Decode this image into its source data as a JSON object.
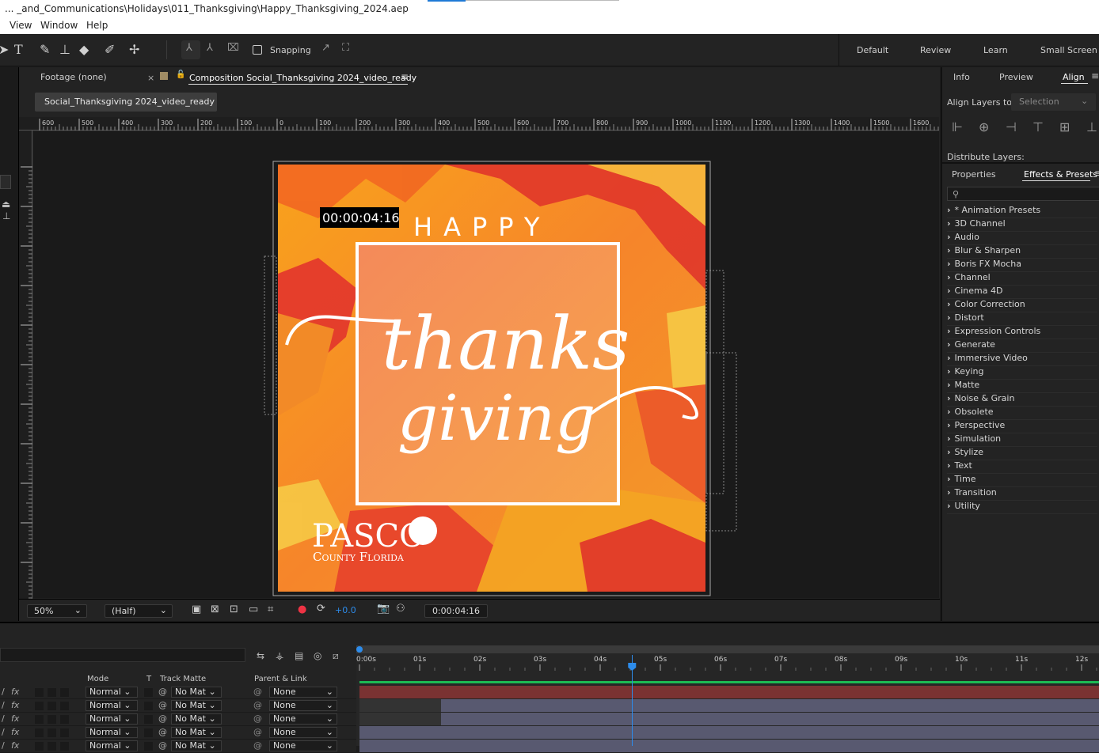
{
  "window": {
    "title": "... _and_Communications\\Holidays\\011_Thanksgiving\\Happy_Thanksgiving_2024.aep"
  },
  "menu": [
    "View",
    "Window",
    "Help"
  ],
  "toolbar": {
    "snapping_label": "Snapping",
    "workspaces": [
      "Default",
      "Review",
      "Learn",
      "Small Screen"
    ]
  },
  "comp_panel": {
    "footage_tab": "Footage (none)",
    "comp_tab": "Composition Social_Thanksgiving 2024_video_ready",
    "breadcrumb": "Social_Thanksgiving 2024_video_ready",
    "ruler_labels": [
      "600",
      "500",
      "400",
      "300",
      "200",
      "100",
      "0",
      "100",
      "200",
      "300",
      "400",
      "500",
      "600",
      "700",
      "800",
      "900",
      "1000",
      "1100",
      "1200",
      "1300",
      "1400",
      "1500",
      "1600"
    ],
    "timecode_overlay": "00:00:04:16",
    "artwork": {
      "happy": "HAPPY",
      "thanks": "thanks",
      "giving": "giving",
      "logo_main": "PASCO",
      "logo_sub": "County Florida"
    },
    "footer": {
      "zoom": "50%",
      "resolution": "(Half)",
      "exposure": "+0.0",
      "timecode": "0:00:04:16"
    }
  },
  "right_panel": {
    "tabs": [
      "Info",
      "Preview",
      "Align"
    ],
    "align_layers_to_label": "Align Layers to:",
    "align_layers_to_value": "Selection",
    "distribute_label": "Distribute Layers:",
    "tabs2": [
      "Properties",
      "Effects & Presets"
    ],
    "effects": [
      "* Animation Presets",
      "3D Channel",
      "Audio",
      "Blur & Sharpen",
      "Boris FX Mocha",
      "Channel",
      "Cinema 4D",
      "Color Correction",
      "Distort",
      "Expression Controls",
      "Generate",
      "Immersive Video",
      "Keying",
      "Matte",
      "Noise & Grain",
      "Obsolete",
      "Perspective",
      "Simulation",
      "Stylize",
      "Text",
      "Time",
      "Transition",
      "Utility"
    ]
  },
  "timeline": {
    "columns": {
      "mode": "Mode",
      "t": "T",
      "track_matte": "Track Matte",
      "parent": "Parent & Link"
    },
    "ruler": [
      "0:00s",
      "01s",
      "02s",
      "03s",
      "04s",
      "05s",
      "06s",
      "07s",
      "08s",
      "09s",
      "10s",
      "11s",
      "12s"
    ],
    "playhead_seconds": 4.53,
    "layers": [
      {
        "mode": "Normal",
        "matte": "No Mat",
        "parent": "None"
      },
      {
        "mode": "Normal",
        "matte": "No Mat",
        "parent": "None"
      },
      {
        "mode": "Normal",
        "matte": "No Mat",
        "parent": "None"
      },
      {
        "mode": "Normal",
        "matte": "No Mat",
        "parent": "None"
      },
      {
        "mode": "Normal",
        "matte": "No Mat",
        "parent": "None"
      }
    ]
  },
  "colors": {
    "accent_blue": "#2d8ceb",
    "work_area_green": "#1db954",
    "layer_red": "#7a3232",
    "layer_purple": "#585970"
  }
}
